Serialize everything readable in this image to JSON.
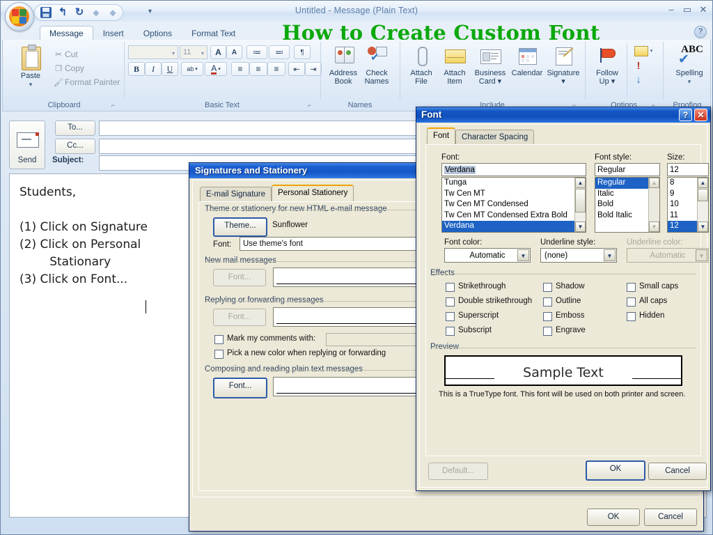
{
  "window": {
    "title": "Untitled - Message (Plain Text)",
    "minimize": "–",
    "maximize": "▭",
    "close": "✕",
    "help": "?"
  },
  "overlay": {
    "title": "How to Create Custom Font",
    "color": "#0aa80a"
  },
  "quick_access": {
    "items": [
      {
        "name": "save-icon",
        "glyph": ""
      },
      {
        "name": "undo-icon",
        "glyph": "↰"
      },
      {
        "name": "redo-icon",
        "glyph": "↻"
      },
      {
        "name": "previous-item-icon",
        "glyph": "◆"
      },
      {
        "name": "next-item-icon",
        "glyph": "◆"
      }
    ],
    "customize": "▾"
  },
  "ribbon": {
    "tabs": [
      {
        "label": "Message",
        "active": true
      },
      {
        "label": "Insert",
        "active": false
      },
      {
        "label": "Options",
        "active": false
      },
      {
        "label": "Format Text",
        "active": false
      }
    ],
    "groups": [
      {
        "label": "Clipboard"
      },
      {
        "label": "Basic Text"
      },
      {
        "label": "Names"
      },
      {
        "label": "Include"
      },
      {
        "label": "Options"
      },
      {
        "label": "Proofing"
      }
    ],
    "clipboard": {
      "paste": "Paste",
      "paste_caret": "▾",
      "cut": "Cut",
      "copy": "Copy",
      "format_painter": "Format Painter"
    },
    "basic_text": {
      "font_name": "",
      "font_size": "11",
      "grow_font": "A",
      "shrink_font": "A",
      "bullets": "≔",
      "numbering": "≕",
      "indent_marks": "¶",
      "bold": "B",
      "italic": "I",
      "underline": "U",
      "highlight": "ab",
      "font_color": "A",
      "align_left": "≡",
      "align_center": "≡",
      "align_right": "≡",
      "decrease_indent": "⇤",
      "increase_indent": "⇥"
    },
    "names": [
      {
        "label1": "Address",
        "label2": "Book",
        "icon": "address-book-icon"
      },
      {
        "label1": "Check",
        "label2": "Names",
        "icon": "check-names-icon"
      }
    ],
    "include": [
      {
        "label1": "Attach",
        "label2": "File",
        "icon": "paperclip-icon"
      },
      {
        "label1": "Attach",
        "label2": "Item",
        "icon": "attach-item-icon"
      },
      {
        "label1": "Business",
        "label2": "Card ▾",
        "icon": "business-card-icon"
      },
      {
        "label1": "Calendar",
        "label2": "",
        "icon": "calendar-icon"
      },
      {
        "label1": "Signature",
        "label2": "▾",
        "icon": "signature-icon"
      }
    ],
    "options": {
      "follow_up_1": "Follow",
      "follow_up_2": "Up ▾",
      "permission_caret": "▾",
      "high_importance": "!",
      "low_importance": "↓"
    },
    "proofing": {
      "spelling_1": "Spelling",
      "spelling_2": "▾",
      "abc": "ABC"
    }
  },
  "compose": {
    "send_button": "Send",
    "to_button": "To...",
    "cc_button": "Cc...",
    "subject_label": "Subject:",
    "to_value": "",
    "cc_value": "",
    "subject_value": "",
    "body": "Students,\n\n(1) Click on Signature\n(2) Click on Personal\n        Stationary\n(3) Click on Font..."
  },
  "signatures_dialog": {
    "title": "Signatures and Stationery",
    "tabs": [
      {
        "label": "E-mail Signature",
        "active": false
      },
      {
        "label": "Personal Stationery",
        "active": true
      }
    ],
    "theme_group_label": "Theme or stationery for new HTML e-mail message",
    "theme_button": "Theme...",
    "theme_value": "Sunflower",
    "font_label": "Font:",
    "font_value": "Use theme's font",
    "new_mail_group_label": "New mail messages",
    "new_mail_font_button": "Font...",
    "reply_group_label": "Replying or forwarding messages",
    "reply_font_button": "Font...",
    "mark_comments_label": "Mark my comments with:",
    "mark_comments_value": "",
    "pick_color_label": "Pick a new color when replying or forwarding",
    "plain_text_group_label": "Composing and reading plain text messages",
    "plain_text_font_button": "Font...",
    "ok_button": "OK",
    "cancel_button": "Cancel"
  },
  "font_dialog": {
    "title": "Font",
    "help_button": "?",
    "close_button": "✕",
    "tabs": [
      {
        "label": "Font",
        "active": true
      },
      {
        "label": "Character Spacing",
        "active": false
      }
    ],
    "font_label": "Font:",
    "font_value": "Verdana",
    "font_list": [
      "Tunga",
      "Tw Cen MT",
      "Tw Cen MT Condensed",
      "Tw Cen MT Condensed Extra Bold",
      "Verdana"
    ],
    "font_selected_index": 4,
    "style_label": "Font style:",
    "style_value": "Regular",
    "style_list": [
      "Regular",
      "Italic",
      "Bold",
      "Bold Italic"
    ],
    "style_selected_index": 0,
    "size_label": "Size:",
    "size_value": "12",
    "size_list": [
      "8",
      "9",
      "10",
      "11",
      "12"
    ],
    "size_selected_index": 4,
    "font_color_label": "Font color:",
    "font_color_value": "Automatic",
    "underline_style_label": "Underline style:",
    "underline_style_value": "(none)",
    "underline_color_label": "Underline color:",
    "underline_color_value": "Automatic",
    "effects_label": "Effects",
    "effects": [
      {
        "label": "Strikethrough",
        "checked": false
      },
      {
        "label": "Double strikethrough",
        "checked": false
      },
      {
        "label": "Superscript",
        "checked": false
      },
      {
        "label": "Subscript",
        "checked": false
      },
      {
        "label": "Shadow",
        "checked": false
      },
      {
        "label": "Outline",
        "checked": false
      },
      {
        "label": "Emboss",
        "checked": false
      },
      {
        "label": "Engrave",
        "checked": false
      },
      {
        "label": "Small caps",
        "checked": false
      },
      {
        "label": "All caps",
        "checked": false
      },
      {
        "label": "Hidden",
        "checked": false
      }
    ],
    "preview_label": "Preview",
    "preview_text": "Sample Text",
    "truetype_note": "This is a TrueType font. This font will be used on both printer and screen.",
    "default_button": "Default...",
    "ok_button": "OK",
    "cancel_button": "Cancel"
  }
}
